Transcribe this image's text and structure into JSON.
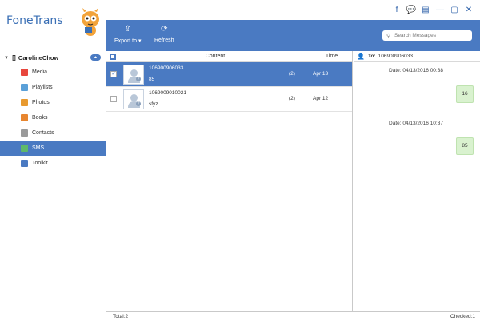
{
  "app": {
    "title": "FoneTrans"
  },
  "window_controls": [
    {
      "name": "facebook-icon",
      "glyph": "f"
    },
    {
      "name": "chat-icon",
      "glyph": "💬"
    },
    {
      "name": "feedback-icon",
      "glyph": "▤"
    },
    {
      "name": "minimize-icon",
      "glyph": "—"
    },
    {
      "name": "maximize-icon",
      "glyph": "▢"
    },
    {
      "name": "close-icon",
      "glyph": "✕"
    }
  ],
  "toolbar": {
    "export_label": "Export to",
    "export_icon": "export-icon",
    "refresh_label": "Refresh",
    "refresh_icon": "refresh-icon",
    "search_placeholder": "Search Messages"
  },
  "sidebar": {
    "device_name": "CarolineChow",
    "items": [
      {
        "label": "Media",
        "icon": "media-icon",
        "color": "#e8473d",
        "active": false
      },
      {
        "label": "Playlists",
        "icon": "playlists-icon",
        "color": "#5aa0d8",
        "active": false
      },
      {
        "label": "Photos",
        "icon": "photos-icon",
        "color": "#e89a2f",
        "active": false
      },
      {
        "label": "Books",
        "icon": "books-icon",
        "color": "#e8862f",
        "active": false
      },
      {
        "label": "Contacts",
        "icon": "contacts-icon",
        "color": "#9a9a9a",
        "active": false
      },
      {
        "label": "SMS",
        "icon": "sms-icon",
        "color": "#5fb96a",
        "active": true
      },
      {
        "label": "Toolkit",
        "icon": "toolkit-icon",
        "color": "#4a7ac2",
        "active": false
      }
    ]
  },
  "list": {
    "col_content": "Content",
    "col_time": "Time",
    "rows": [
      {
        "number": "106900906033",
        "preview": "85",
        "count": "(2)",
        "date": "Apr 13",
        "selected": true,
        "checked": true
      },
      {
        "number": "1069009010021",
        "preview": "sfyz",
        "count": "(2)",
        "date": "Apr 12",
        "selected": false,
        "checked": false
      }
    ]
  },
  "conversation": {
    "to_label": "To:",
    "to_number": "106900906033",
    "messages": [
      {
        "date": "Date: 04/13/2016 00:38",
        "text": "16"
      },
      {
        "date": "Date: 04/13/2016 10:37",
        "text": "85"
      }
    ]
  },
  "status": {
    "total": "Total:2",
    "checked": "Checked:1"
  },
  "colors": {
    "accent": "#4a7ac2",
    "bubble": "#d9f2cf"
  }
}
